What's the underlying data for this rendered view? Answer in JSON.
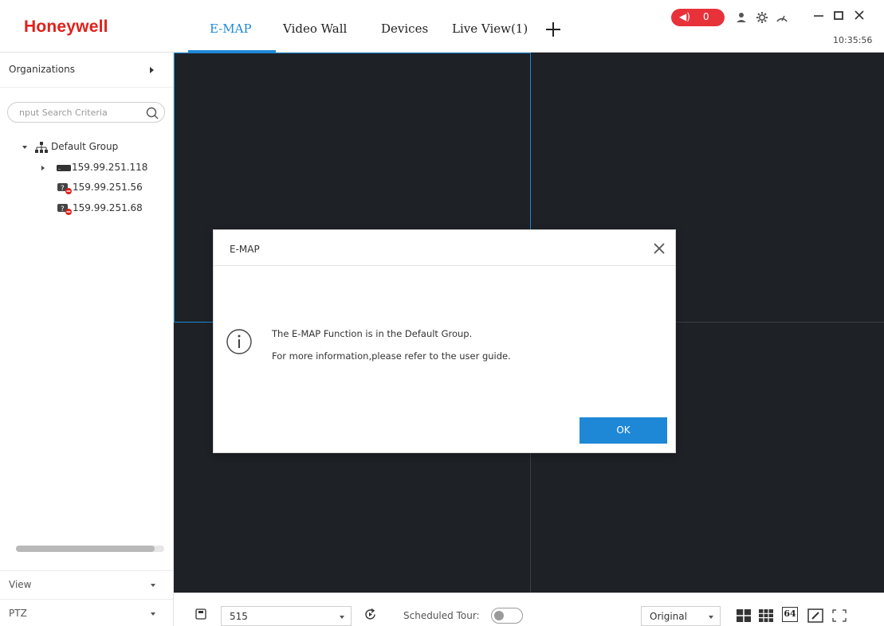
{
  "app": {
    "logo": "Honeywell",
    "brand_color": "#e0201b",
    "accent_color": "#1e88d6"
  },
  "header": {
    "tabs": [
      {
        "label": "E-MAP",
        "active": true
      },
      {
        "label": "Video Wall",
        "active": false
      },
      {
        "label": "Devices",
        "active": false
      },
      {
        "label": "Live View(1)",
        "active": false
      }
    ],
    "add_tab_icon": "plus-icon",
    "alarm_count": "0",
    "alarm_icon": "speaker-icon",
    "icons": [
      "user-icon",
      "gear-icon",
      "speedometer-icon",
      "minimize-icon",
      "maximize-icon",
      "close-icon"
    ],
    "clock": "10:35:56"
  },
  "sidebar": {
    "organizations_label": "Organizations",
    "search": {
      "placeholder": "nput Search Criteria"
    },
    "tree": {
      "group_label": "Default Group",
      "devices": [
        {
          "label": "159.99.251.118",
          "status": "online"
        },
        {
          "label": "159.99.251.56",
          "status": "offline"
        },
        {
          "label": "159.99.251.68",
          "status": "offline"
        }
      ]
    },
    "view_label": "View",
    "ptz_label": "PTZ"
  },
  "toolbar": {
    "view_select_value": "515",
    "scheduled_tour_label": "Scheduled Tour:",
    "scheduled_tour_on": false,
    "ratio_select_value": "Original",
    "layout_64_label": "64"
  },
  "dialog": {
    "title": "E-MAP",
    "message_line1": "The E-MAP Function is in the Default Group.",
    "message_line2": "For more information,please refer to the user guide.",
    "ok_label": "OK"
  }
}
